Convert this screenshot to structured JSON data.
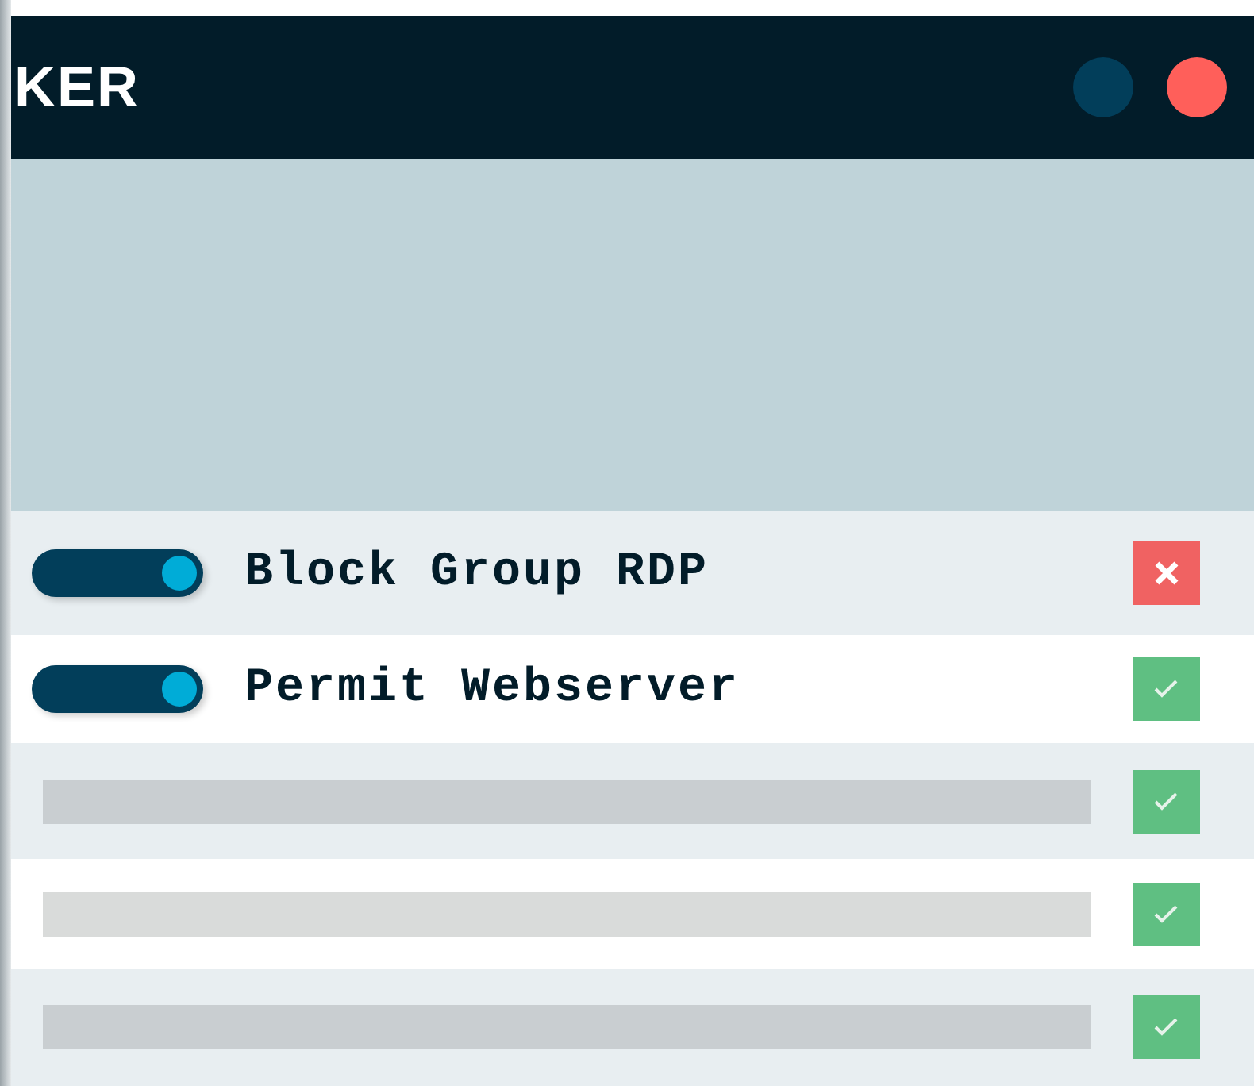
{
  "header": {
    "title": "KER",
    "buttons": [
      {
        "color": "#023e5a"
      },
      {
        "color": "#ff5f5a"
      }
    ]
  },
  "rules": [
    {
      "kind": "rule",
      "on": true,
      "label": "Block Group RDP",
      "allowed": false
    },
    {
      "kind": "rule",
      "on": true,
      "label": "Permit Webserver",
      "allowed": true
    },
    {
      "kind": "placeholder",
      "allowed": true
    },
    {
      "kind": "placeholder",
      "allowed": true
    },
    {
      "kind": "placeholder",
      "allowed": true
    }
  ]
}
